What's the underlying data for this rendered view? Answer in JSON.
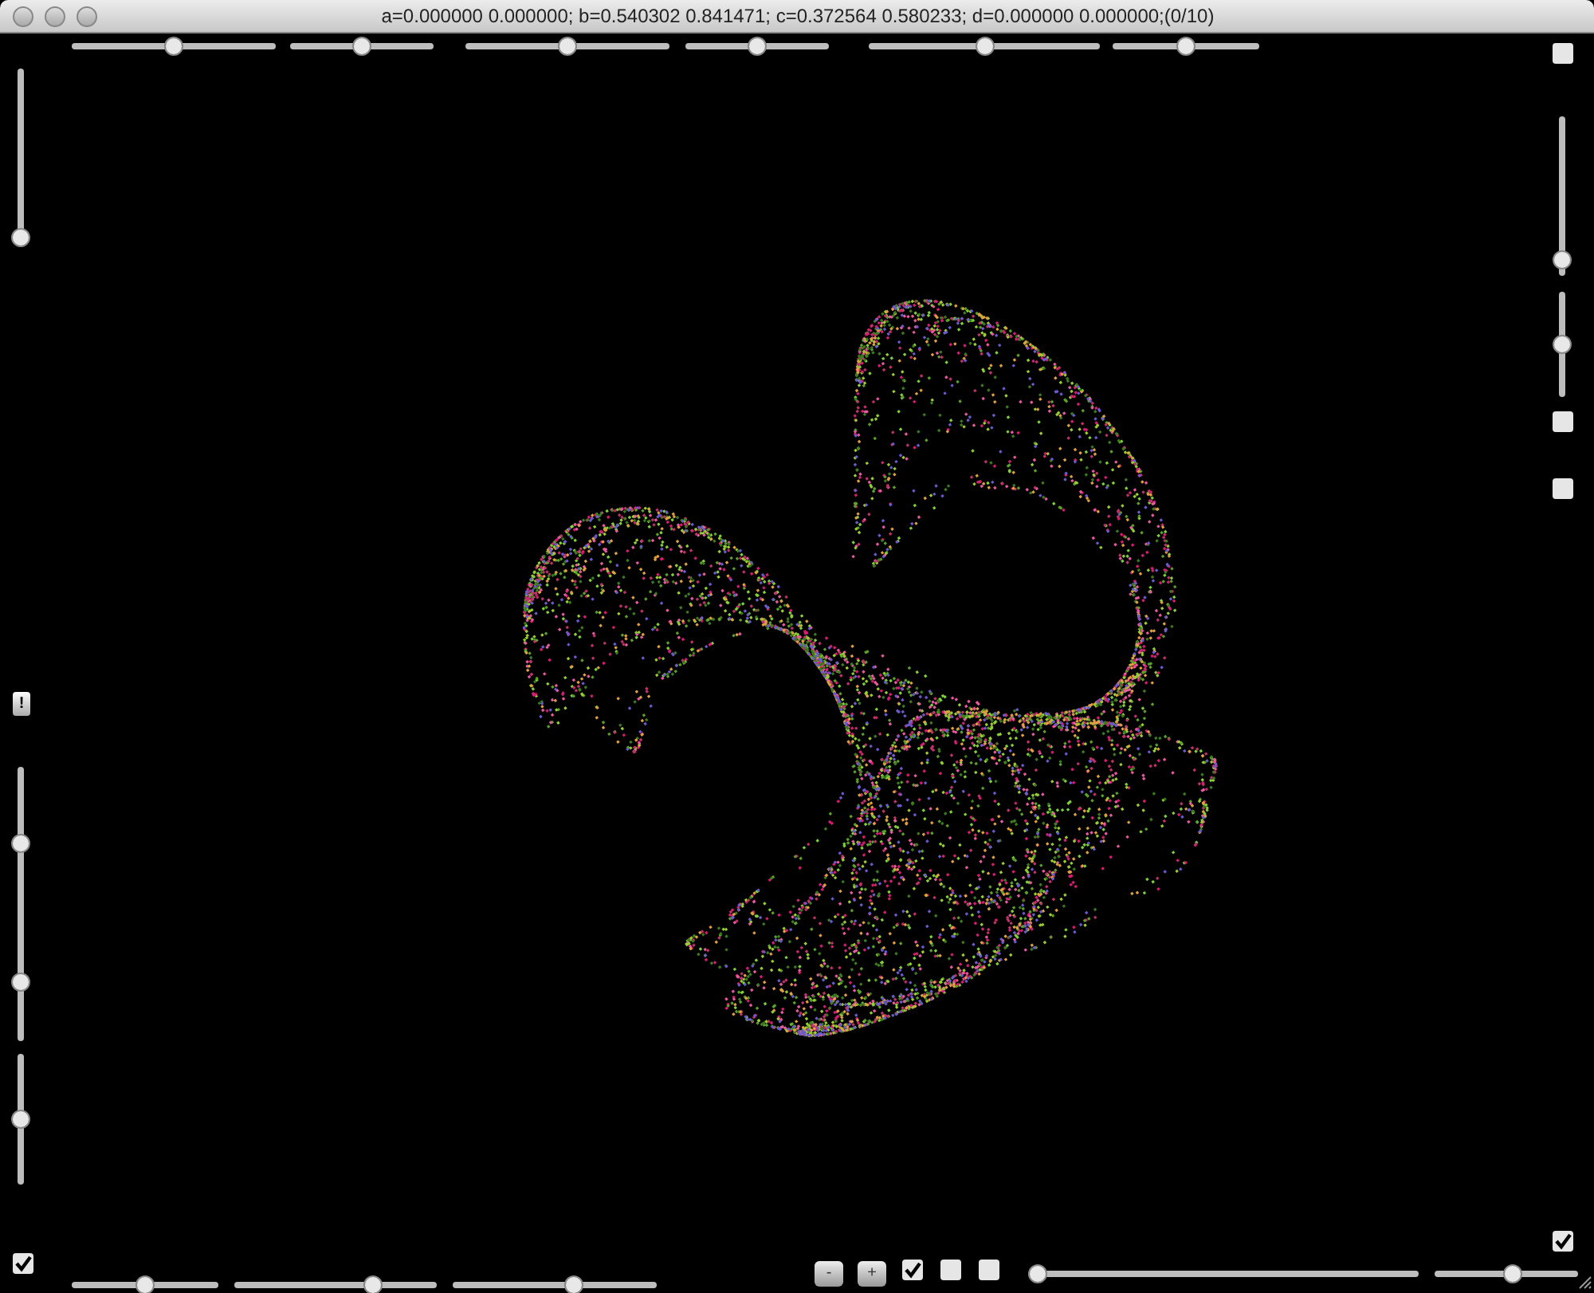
{
  "window": {
    "title": "a=0.000000 0.000000; b=0.540302 0.841471; c=0.372564 0.580233; d=0.000000 0.000000;(0/10)"
  },
  "top_sliders": [
    {
      "level": 0.5
    },
    {
      "level": 0.5
    },
    {
      "level": 0.5
    },
    {
      "level": 0.5
    },
    {
      "level": 0.5
    },
    {
      "level": 0.5
    }
  ],
  "left_top_slider": {
    "level": 0
  },
  "right_controls": {
    "top_checkbox": {
      "checked": false
    },
    "sliders": [
      {
        "level": 0.05
      },
      {
        "level": 0.5
      }
    ],
    "checkboxes": [
      {
        "checked": false
      },
      {
        "checked": false
      }
    ]
  },
  "left_controls": {
    "alert_button": "!",
    "sliders": [
      {
        "level": 0.5
      },
      {
        "level": 0.45
      },
      {
        "level": 0.5
      }
    ],
    "checkbox": {
      "checked": true
    }
  },
  "bottom_sliders": [
    {
      "level": 0.5
    },
    {
      "level": 0.7
    },
    {
      "level": 0.6
    }
  ],
  "bottom_controls": {
    "buttons": [
      "-",
      "+"
    ],
    "checkboxes": [
      {
        "checked": true
      },
      {
        "checked": false
      },
      {
        "checked": false
      }
    ],
    "sliders": [
      {
        "level": 0
      },
      {
        "level": 0.55
      }
    ]
  },
  "corner_checkbox": {
    "checked": true
  }
}
